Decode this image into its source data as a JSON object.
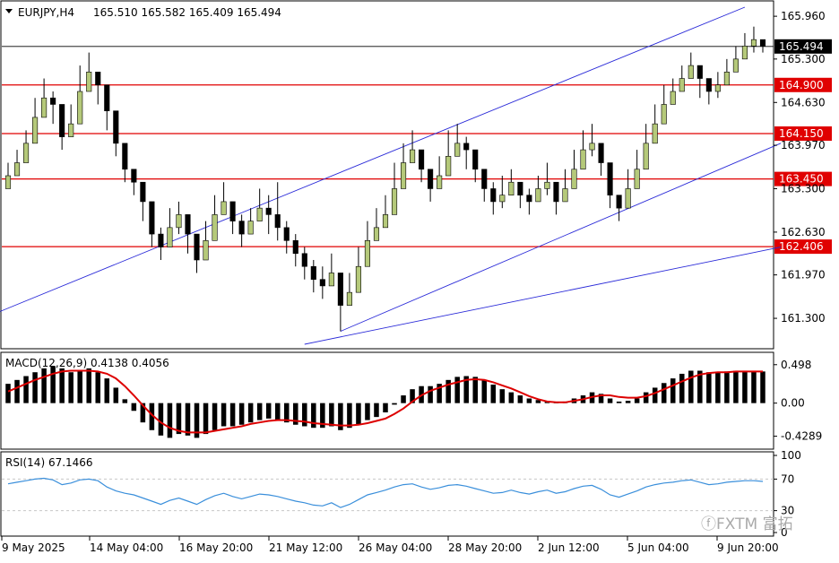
{
  "window": {
    "symbol_label": "EURJPY,H4",
    "ohlc_label": "165.510 165.582 165.409 165.494"
  },
  "watermark": "ⓕFXTM 富拓",
  "colors": {
    "up_candle": "#b5c97a",
    "down_candle": "#000000",
    "channel_lines": "#2a2ad8",
    "support_lines": "#e00000",
    "macd_signal": "#dd0000",
    "rsi_line": "#3a8fdb",
    "grid": "#c8c8c8",
    "axis": "#000000"
  },
  "chart_data": [
    {
      "type": "candlestick",
      "name": "price",
      "symbol": "EURJPY",
      "timeframe": "H4",
      "ylim": [
        160.9,
        166.1
      ],
      "y_ticks": [
        "165.960",
        "165.300",
        "164.630",
        "163.970",
        "163.300",
        "162.630",
        "161.970",
        "161.300"
      ],
      "x_tick_labels": [
        "9 May 2025",
        "14 May 04:00",
        "16 May 20:00",
        "21 May 12:00",
        "26 May 04:00",
        "28 May 20:00",
        "2 Jun 12:00",
        "5 Jun 04:00",
        "9 Jun 20:00"
      ],
      "current_price": "165.494",
      "horizontal_levels": [
        "164.900",
        "164.150",
        "163.450",
        "162.406"
      ],
      "closes": [
        163.5,
        163.7,
        164.0,
        164.4,
        164.7,
        164.6,
        164.1,
        164.3,
        164.8,
        165.1,
        164.9,
        164.5,
        164.0,
        163.6,
        163.4,
        163.1,
        162.6,
        162.4,
        162.7,
        162.9,
        162.6,
        162.2,
        162.5,
        162.9,
        163.1,
        162.8,
        162.6,
        162.8,
        163.0,
        162.9,
        162.7,
        162.5,
        162.3,
        162.1,
        161.9,
        161.8,
        162.0,
        161.5,
        161.7,
        162.1,
        162.5,
        162.7,
        162.9,
        163.3,
        163.7,
        163.9,
        163.6,
        163.3,
        163.5,
        163.8,
        164.0,
        163.9,
        163.6,
        163.3,
        163.1,
        163.2,
        163.4,
        163.2,
        163.1,
        163.3,
        163.4,
        163.1,
        163.3,
        163.6,
        163.9,
        164.0,
        163.7,
        163.2,
        163.0,
        163.3,
        163.6,
        164.0,
        164.3,
        164.6,
        164.8,
        165.0,
        165.2,
        165.0,
        164.8,
        164.9,
        165.1,
        165.3,
        165.5,
        165.6,
        165.5
      ],
      "highs": [
        163.7,
        163.9,
        164.2,
        164.7,
        165.0,
        164.8,
        164.4,
        164.6,
        165.2,
        165.4,
        165.1,
        164.7,
        164.2,
        163.8,
        163.6,
        163.3,
        162.9,
        162.7,
        163.0,
        163.1,
        162.9,
        162.5,
        162.8,
        163.2,
        163.4,
        163.0,
        162.9,
        163.0,
        163.3,
        163.2,
        163.4,
        162.8,
        162.6,
        162.4,
        162.2,
        162.1,
        162.3,
        162.0,
        162.0,
        162.4,
        162.8,
        163.0,
        163.2,
        163.7,
        164.0,
        164.2,
        163.9,
        163.6,
        163.8,
        164.2,
        164.3,
        164.1,
        163.8,
        163.5,
        163.4,
        163.5,
        163.6,
        163.4,
        163.3,
        163.5,
        163.7,
        163.4,
        163.6,
        163.9,
        164.2,
        164.3,
        164.0,
        163.5,
        163.2,
        163.6,
        163.9,
        164.3,
        164.6,
        164.9,
        165.0,
        165.2,
        165.4,
        165.2,
        165.0,
        165.1,
        165.3,
        165.5,
        165.7,
        165.8,
        165.6
      ],
      "lows": [
        163.3,
        163.5,
        163.8,
        164.2,
        164.5,
        164.3,
        163.9,
        164.1,
        164.6,
        164.9,
        164.6,
        164.2,
        163.8,
        163.4,
        163.2,
        162.8,
        162.4,
        162.2,
        162.5,
        162.6,
        162.3,
        162.0,
        162.3,
        162.7,
        162.9,
        162.6,
        162.4,
        162.6,
        162.8,
        162.6,
        162.5,
        162.3,
        162.1,
        161.9,
        161.7,
        161.6,
        161.8,
        161.1,
        161.5,
        161.9,
        162.3,
        162.5,
        162.7,
        163.1,
        163.5,
        163.7,
        163.4,
        163.1,
        163.3,
        163.6,
        163.8,
        163.6,
        163.4,
        163.1,
        162.9,
        163.0,
        163.2,
        163.0,
        162.9,
        163.1,
        163.2,
        162.9,
        163.1,
        163.4,
        163.7,
        163.8,
        163.5,
        163.0,
        162.8,
        163.1,
        163.4,
        163.8,
        164.1,
        164.4,
        164.6,
        164.8,
        165.0,
        164.7,
        164.6,
        164.7,
        164.9,
        165.1,
        165.3,
        165.4,
        165.4
      ]
    },
    {
      "type": "bar",
      "name": "MACD",
      "label": "MACD(12,26,9) 0.4138 0.4056",
      "y_ticks": [
        "0.498",
        "0.00",
        "-0.4289"
      ],
      "ylim": [
        -0.55,
        0.6
      ],
      "histogram": [
        0.25,
        0.3,
        0.35,
        0.4,
        0.45,
        0.48,
        0.45,
        0.4,
        0.42,
        0.45,
        0.4,
        0.32,
        0.2,
        0.05,
        -0.1,
        -0.25,
        -0.35,
        -0.42,
        -0.45,
        -0.4,
        -0.42,
        -0.45,
        -0.4,
        -0.35,
        -0.3,
        -0.3,
        -0.28,
        -0.25,
        -0.22,
        -0.2,
        -0.22,
        -0.25,
        -0.28,
        -0.3,
        -0.32,
        -0.32,
        -0.3,
        -0.35,
        -0.32,
        -0.28,
        -0.22,
        -0.18,
        -0.12,
        -0.02,
        0.1,
        0.18,
        0.22,
        0.22,
        0.25,
        0.3,
        0.34,
        0.35,
        0.34,
        0.3,
        0.24,
        0.18,
        0.14,
        0.1,
        0.06,
        0.04,
        0.03,
        0.01,
        0.02,
        0.06,
        0.1,
        0.14,
        0.12,
        0.06,
        0.02,
        0.03,
        0.06,
        0.14,
        0.2,
        0.26,
        0.32,
        0.38,
        0.42,
        0.42,
        0.4,
        0.4,
        0.41,
        0.42,
        0.42,
        0.42,
        0.41
      ],
      "signal": [
        0.15,
        0.2,
        0.25,
        0.3,
        0.34,
        0.38,
        0.41,
        0.42,
        0.42,
        0.42,
        0.41,
        0.38,
        0.32,
        0.22,
        0.1,
        -0.03,
        -0.15,
        -0.25,
        -0.32,
        -0.36,
        -0.38,
        -0.38,
        -0.38,
        -0.36,
        -0.34,
        -0.32,
        -0.3,
        -0.27,
        -0.25,
        -0.23,
        -0.22,
        -0.22,
        -0.23,
        -0.24,
        -0.26,
        -0.27,
        -0.28,
        -0.29,
        -0.29,
        -0.28,
        -0.26,
        -0.23,
        -0.2,
        -0.14,
        -0.07,
        0.02,
        0.1,
        0.16,
        0.2,
        0.24,
        0.27,
        0.3,
        0.31,
        0.3,
        0.27,
        0.23,
        0.19,
        0.14,
        0.09,
        0.05,
        0.02,
        0.01,
        0.01,
        0.03,
        0.05,
        0.08,
        0.1,
        0.1,
        0.08,
        0.07,
        0.07,
        0.09,
        0.13,
        0.18,
        0.23,
        0.28,
        0.33,
        0.37,
        0.39,
        0.4,
        0.4,
        0.41,
        0.41,
        0.41,
        0.41
      ]
    },
    {
      "type": "line",
      "name": "RSI",
      "label": "RSI(14) 67.1466",
      "y_ticks": [
        "100",
        "70",
        "30",
        "0"
      ],
      "ylim": [
        0,
        100
      ],
      "values": [
        64,
        66,
        68,
        70,
        71,
        69,
        63,
        65,
        69,
        70,
        68,
        60,
        55,
        52,
        50,
        46,
        42,
        38,
        43,
        46,
        42,
        38,
        44,
        49,
        52,
        48,
        45,
        48,
        51,
        50,
        48,
        45,
        42,
        40,
        37,
        36,
        40,
        34,
        38,
        44,
        50,
        53,
        56,
        60,
        63,
        64,
        60,
        57,
        59,
        62,
        63,
        61,
        58,
        55,
        52,
        53,
        56,
        53,
        51,
        54,
        56,
        52,
        54,
        58,
        61,
        62,
        57,
        50,
        47,
        51,
        55,
        60,
        63,
        65,
        66,
        68,
        69,
        66,
        63,
        64,
        66,
        67,
        68,
        68,
        67
      ]
    }
  ]
}
